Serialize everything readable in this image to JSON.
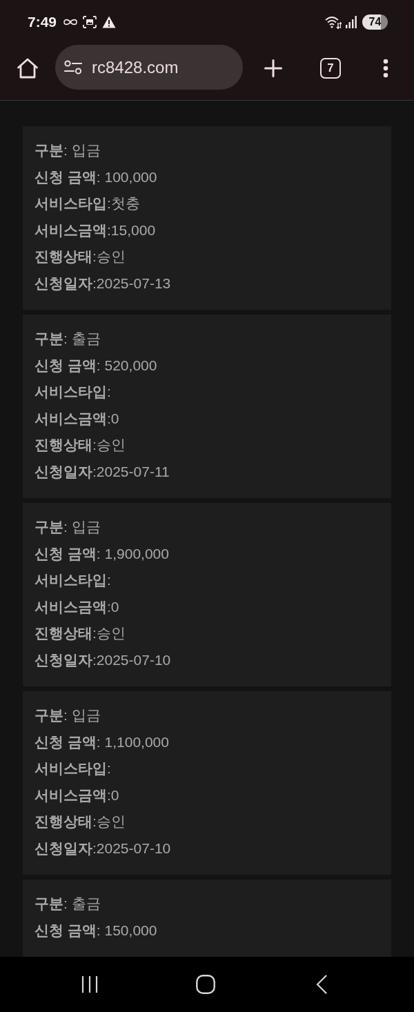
{
  "status_bar": {
    "time": "7:49",
    "battery": "74"
  },
  "browser_bar": {
    "url": "rc8428.com",
    "tab_count": "7"
  },
  "records": [
    {
      "lines": [
        "**구분**: 입금",
        "**신청 금액**: 100,000",
        "**서비스타입**:첫충",
        "**서비스금액**:15,000",
        "**진행상태**:승인",
        "**신청일자**:2025-07-13"
      ]
    },
    {
      "lines": [
        "**구분**: 출금",
        "**신청 금액**: 520,000",
        "**서비스타입**:",
        "**서비스금액**:0",
        "**진행상태**:승인",
        "**신청일자**:2025-07-11"
      ]
    },
    {
      "lines": [
        "**구분**: 입금",
        "**신청 금액**: 1,900,000",
        "**서비스타입**:",
        "**서비스금액**:0",
        "**진행상태**:승인",
        "**신청일자**:2025-07-10"
      ]
    },
    {
      "lines": [
        "**구분**: 입금",
        "**신청 금액**: 1,100,000",
        "**서비스타입**:",
        "**서비스금액**:0",
        "**진행상태**:승인",
        "**신청일자**:2025-07-10"
      ]
    },
    {
      "lines": [
        "**구분**: 출금",
        "**신청 금액**: 150,000"
      ]
    }
  ]
}
